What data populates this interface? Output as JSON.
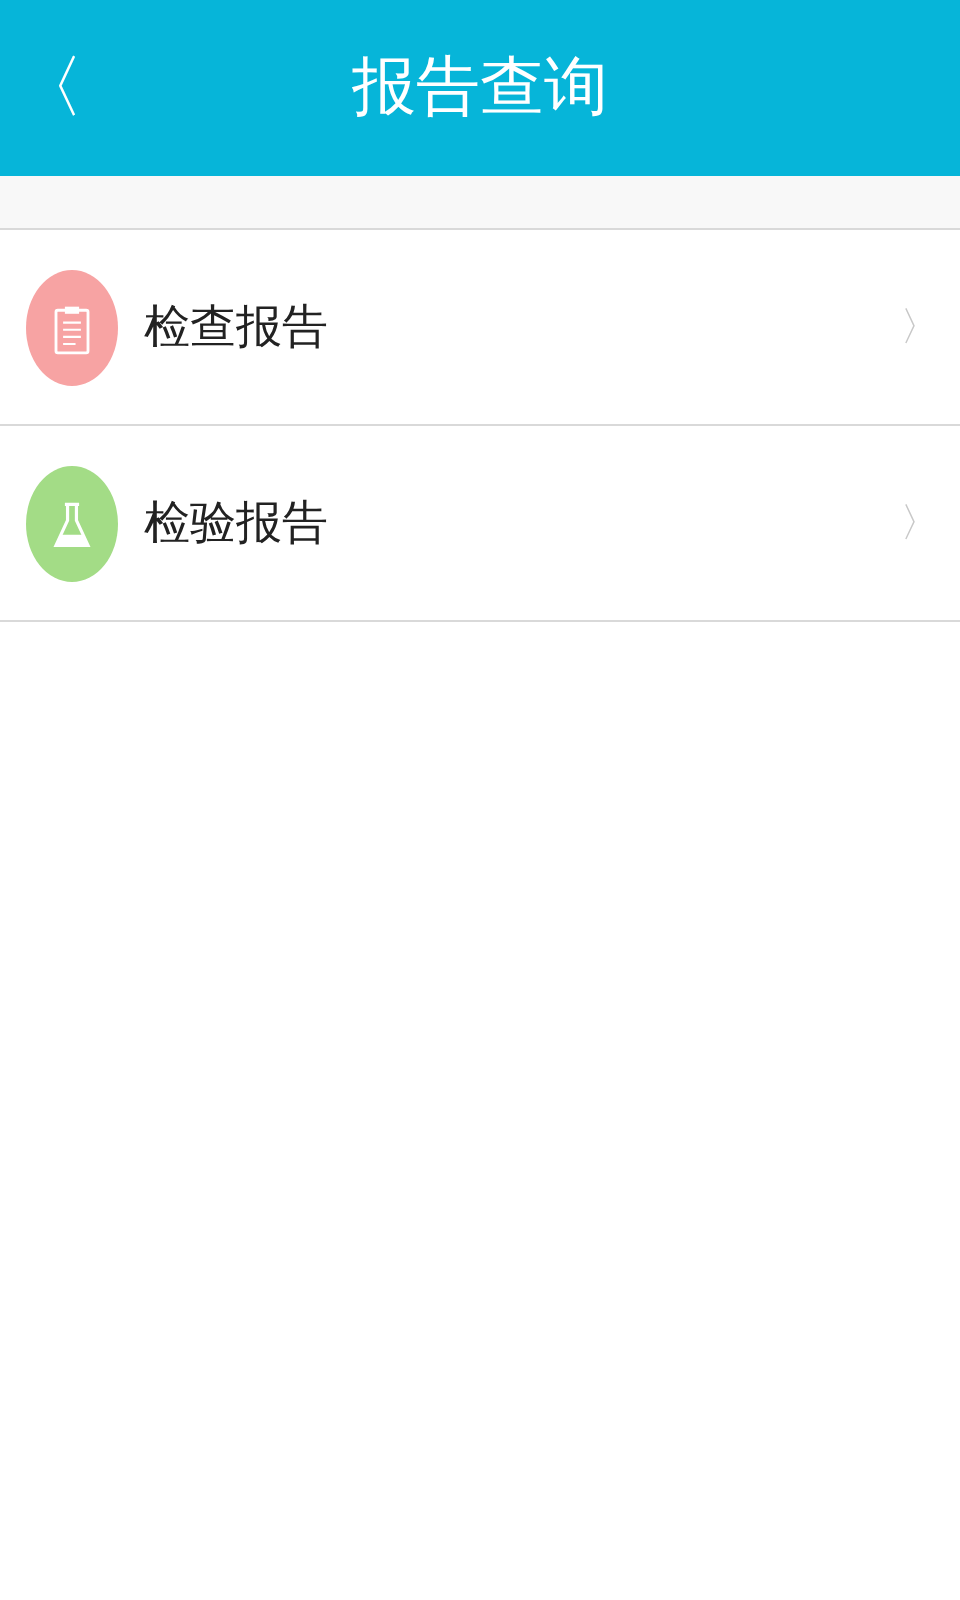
{
  "header": {
    "back": "〈",
    "title": "报告查询"
  },
  "items": [
    {
      "label": "检查报告",
      "kind": "clipboard",
      "color": "#f7a3a3",
      "chevron": "〉"
    },
    {
      "label": "检验报告",
      "kind": "flask",
      "color": "#a3dc86",
      "chevron": "〉"
    }
  ]
}
